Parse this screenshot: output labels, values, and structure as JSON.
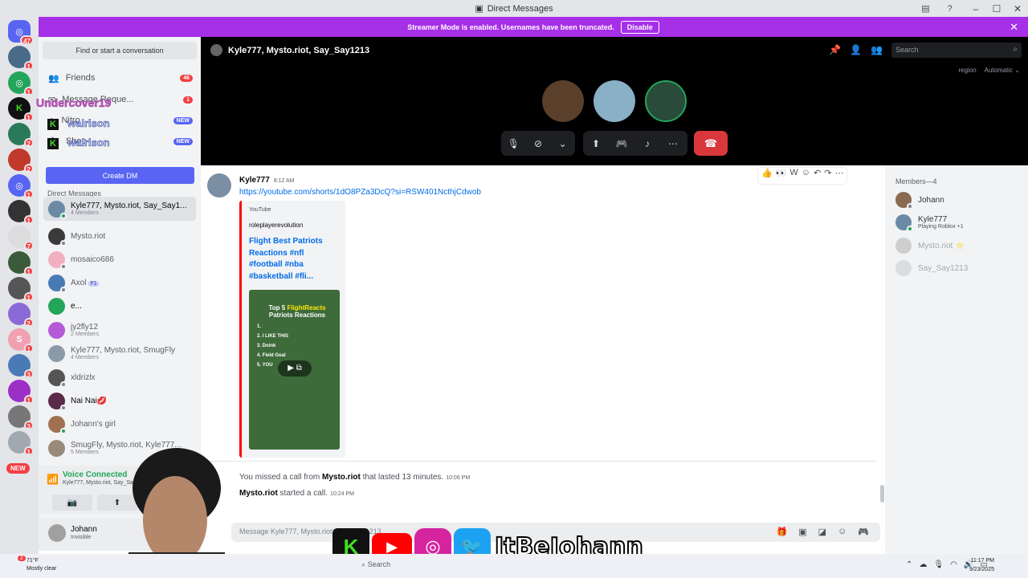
{
  "window": {
    "title": "Direct Messages"
  },
  "banner": {
    "text": "Streamer Mode is enabled. Usernames have been truncated.",
    "button": "Disable"
  },
  "guild_badges": [
    "47",
    "1",
    "1",
    "1",
    "2",
    "2",
    "1",
    "1",
    "7",
    "1",
    "1",
    "2",
    "1",
    "3",
    "1",
    "3",
    "1"
  ],
  "new_pill": "NEW",
  "sidebar": {
    "find": "Find or start a conversation",
    "friends": "Friends",
    "friends_badge": "46",
    "requests": "Message Reque...",
    "requests_badge": "1",
    "nitro": "Nitro",
    "shop": "Shop",
    "new_label": "NEW",
    "create_dm": "Create DM",
    "direct_messages": "Direct Messages",
    "dms": [
      {
        "name": "Kyle777, Mysto.riot, Say_Say1...",
        "sub": "4 Members",
        "color": "#6b8aa6"
      },
      {
        "name": "Mysto.riot",
        "sub": "",
        "color": "#3a3a3a"
      },
      {
        "name": "mosaico686",
        "sub": "",
        "color": "#f0b0c0"
      },
      {
        "name": "Axol",
        "sub": "",
        "tag": "F1",
        "color": "#4a7ab5"
      },
      {
        "name": "e...",
        "sub": "",
        "color": "#23a55a"
      },
      {
        "name": "jy2fly12",
        "sub": "2 Members",
        "color": "#b45ad6"
      },
      {
        "name": "Kyle777, Mysto.riot, SmugFly",
        "sub": "4 Members",
        "color": "#8a9aa8"
      },
      {
        "name": "xldrizlx",
        "sub": "",
        "color": "#555"
      },
      {
        "name": "Nai Nai💋",
        "sub": "",
        "color": "#5a2a4a"
      },
      {
        "name": "Johann's girl",
        "sub": "",
        "color": "#a07050"
      },
      {
        "name": "SmugFly, Mysto.riot, Kyle777...",
        "sub": "5 Members",
        "color": "#9a8a7a"
      }
    ]
  },
  "voice": {
    "status": "Voice Connected",
    "channel": "Kyle777, Mysto.riot, Say_Say1213"
  },
  "user": {
    "name": "Johann",
    "status": "Invisible"
  },
  "call": {
    "title": "Kyle777, Mysto.riot, Say_Say1213",
    "search_placeholder": "Search",
    "region_label": "region",
    "region_value": "Automatic"
  },
  "message": {
    "author": "Kyle777",
    "time": "8:12 AM",
    "link": "https://youtube.com/shorts/1dO8PZa3DcQ?si=RSW401NcthjCdwob",
    "embed": {
      "provider": "YouTube",
      "author": "roleplayerevolution",
      "title": "Flight Best Patriots Reactions #nfl #football #nba #basketball #fli...",
      "thumb_title_a": "Top 5 ",
      "thumb_title_b": "FlightReacts",
      "thumb_title_c": " Patriots Reactions",
      "thumb_list": [
        "1.",
        "2. I LIKE THIS",
        "3. Doink",
        "4. Field Goal",
        "5. YOU"
      ]
    }
  },
  "system": [
    {
      "pre": "You missed a call from ",
      "name": "Mysto.riot",
      "post": " that lasted 13 minutes.",
      "time": "10:06 PM"
    },
    {
      "pre": "",
      "name": "Mysto.riot",
      "post": " started a call.",
      "time": "10:24 PM"
    }
  ],
  "composer": {
    "placeholder": "Message Kyle777, Mysto.riot, Say_Say1213"
  },
  "members": {
    "header": "Members—4",
    "list": [
      {
        "name": "Johann",
        "activity": "",
        "color": "#8a6a50"
      },
      {
        "name": "Kyle777",
        "activity": "Playing Roblox +1",
        "color": "#6b8aa6"
      },
      {
        "name": "Mysto.riot ⭐",
        "activity": "",
        "color": "#999"
      },
      {
        "name": "Say_Say1213",
        "activity": "",
        "color": "#bbb"
      }
    ]
  },
  "overlay": {
    "name": "Undercover19",
    "user": "walrison",
    "handle": "ItBeJohann"
  },
  "taskbar": {
    "temp": "71°F",
    "weather": "Mostly clear",
    "search": "Search",
    "time": "11:17 PM",
    "date": "9/23/2025",
    "notif": "2"
  },
  "colors": {
    "accent": "#5865f2",
    "streamer": "#a62fe8",
    "danger": "#da373c",
    "online": "#23a55a"
  }
}
